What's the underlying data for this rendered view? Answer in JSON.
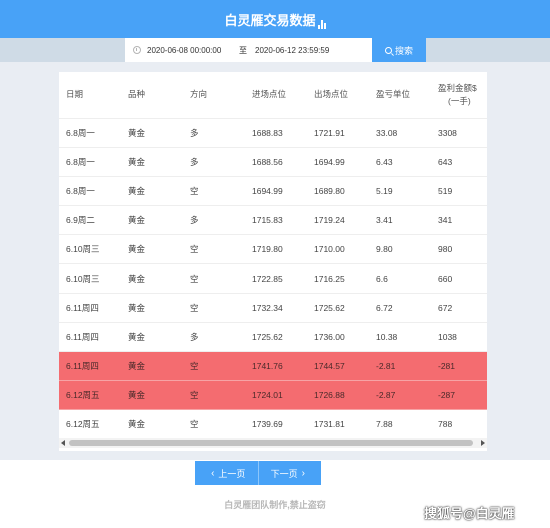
{
  "header": {
    "title": "白灵雁交易数据"
  },
  "search": {
    "start": "2020-06-08 00:00:00",
    "separator": "至",
    "end": "2020-06-12 23:59:59",
    "button_label": "搜索"
  },
  "table": {
    "columns": [
      "日期",
      "品种",
      "方向",
      "进场点位",
      "出场点位",
      "盈亏单位",
      "盈利金额$(一手)"
    ],
    "rows": [
      [
        "6.8周一",
        "黄金",
        "多",
        "1688.83",
        "1721.91",
        "33.08",
        "3308"
      ],
      [
        "6.8周一",
        "黄金",
        "多",
        "1688.56",
        "1694.99",
        "6.43",
        "643"
      ],
      [
        "6.8周一",
        "黄金",
        "空",
        "1694.99",
        "1689.80",
        "5.19",
        "519"
      ],
      [
        "6.9周二",
        "黄金",
        "多",
        "1715.83",
        "1719.24",
        "3.41",
        "341"
      ],
      [
        "6.10周三",
        "黄金",
        "空",
        "1719.80",
        "1710.00",
        "9.80",
        "980"
      ],
      [
        "6.10周三",
        "黄金",
        "空",
        "1722.85",
        "1716.25",
        "6.6",
        "660"
      ],
      [
        "6.11周四",
        "黄金",
        "空",
        "1732.34",
        "1725.62",
        "6.72",
        "672"
      ],
      [
        "6.11周四",
        "黄金",
        "多",
        "1725.62",
        "1736.00",
        "10.38",
        "1038"
      ],
      [
        "6.11周四",
        "黄金",
        "空",
        "1741.76",
        "1744.57",
        "-2.81",
        "-281"
      ],
      [
        "6.12周五",
        "黄金",
        "空",
        "1724.01",
        "1726.88",
        "-2.87",
        "-287"
      ],
      [
        "6.12周五",
        "黄金",
        "空",
        "1739.69",
        "1731.81",
        "7.88",
        "788"
      ]
    ],
    "loss_color": "#f46c70"
  },
  "pagination": {
    "prev_label": "上一页",
    "next_label": "下一页"
  },
  "footer": {
    "copyright": "白灵雁团队制作,禁止盗窃"
  },
  "watermark": "搜狐号@白灵雁",
  "colors": {
    "accent": "#48a2f7",
    "loss_row": "#f46c70"
  }
}
